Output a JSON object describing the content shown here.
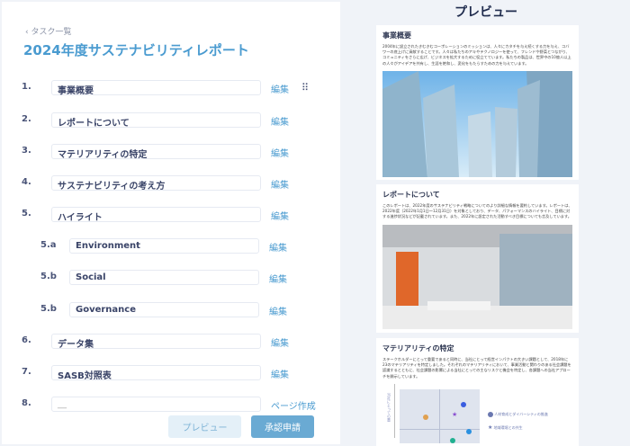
{
  "back_link": "タスク一覧",
  "title": "2024年度サステナビリティレポート",
  "sections": [
    {
      "num": "1.",
      "label": "事業概要",
      "action": "編集",
      "sub": false
    },
    {
      "num": "2.",
      "label": "レポートについて",
      "action": "編集",
      "sub": false
    },
    {
      "num": "3.",
      "label": "マテリアリティの特定",
      "action": "編集",
      "sub": false
    },
    {
      "num": "4.",
      "label": "サステナビリティの考え方",
      "action": "編集",
      "sub": false
    },
    {
      "num": "5.",
      "label": "ハイライト",
      "action": "編集",
      "sub": false
    },
    {
      "num": "5.a",
      "label": "Environment",
      "action": "編集",
      "sub": true
    },
    {
      "num": "5.b",
      "label": "Social",
      "action": "編集",
      "sub": true
    },
    {
      "num": "5.b",
      "label": "Governance",
      "action": "編集",
      "sub": true
    },
    {
      "num": "6.",
      "label": "データ集",
      "action": "編集",
      "sub": false
    },
    {
      "num": "7.",
      "label": "SASB対照表",
      "action": "編集",
      "sub": false
    },
    {
      "num": "8.",
      "label": "__",
      "action": "ページ作成",
      "sub": false
    }
  ],
  "buttons": {
    "preview": "プレビュー",
    "approve": "承認申請"
  },
  "preview": {
    "heading": "プレビュー",
    "cards": [
      {
        "title": "事業概要",
        "text": "2004年に設立されたきむきむコーポレーションのミッションは、人々にカタチを与え続くする力を与え、コバワーの底上げに貢献することです。人々は私たちのアキやテクノロジーを使って、フレンドや野菜とつながり、コミュニティをさらに広げ、ビジネスを拡大するために役立てています。私たちの製品は、世界中の10億人以上の人々がアイデアを共有し、生涯を絶和し、変化をもたらすための力を与えています。"
      },
      {
        "title": "レポートについて",
        "text": "このレポートは、2022年度のサステナビリティ戦略についてのより詳細な情報を要約しています。レポートは、2022年度（2022年1月1日〜12月31日）を対象としており、データ、パフォーマンスのハイライト、目標に対する進捗状況などが記載されています。また、2022年に設定された活動すべき目標についても言及しています。"
      },
      {
        "title": "マテリアリティの特定",
        "text": "ステークホルダーにとって重要であると同時に、当社にとって経営インパクトの大きい課題として、2018年に23のマテリアリティを特定しました。それぞれのマテリアリティにおいて、事業活動と関わりのある社会課題を認識するとともに、社会課題の影響による当社にとっての主なリスクと機会を特定し、各課題への当社アプローチを開示しています。",
        "axis_label": "当社にとっての重",
        "legend": [
          "人材育成とダイバーシティの推進",
          "地域環境との共生"
        ]
      }
    ]
  },
  "colors": {
    "accent": "#4a9bd0",
    "approve_bg": "#6aaad3",
    "preview_btn_bg": "#e4f0f8"
  }
}
